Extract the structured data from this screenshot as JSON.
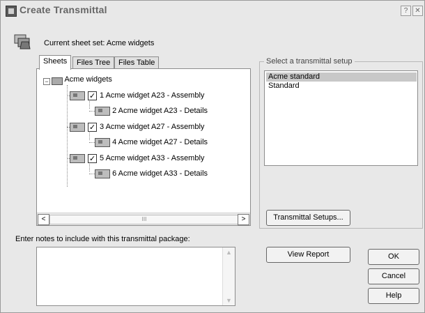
{
  "window": {
    "title": "Create Transmittal"
  },
  "titlebar_buttons": {
    "help": "?",
    "close": "✕"
  },
  "header": {
    "current_sheet_set": "Current sheet set: Acme widgets"
  },
  "tabs": [
    {
      "label": "Sheets",
      "active": true
    },
    {
      "label": "Files Tree",
      "active": false
    },
    {
      "label": "Files Table",
      "active": false
    }
  ],
  "tree": {
    "root": "Acme widgets",
    "expander": "−",
    "items": [
      {
        "label": "1 Acme widget A23 - Assembly",
        "checked": true
      },
      {
        "label": "2 Acme widget A23 - Details",
        "checked": null
      },
      {
        "label": "3 Acme widget A27 - Assembly",
        "checked": true
      },
      {
        "label": "4 Acme widget A27 - Details",
        "checked": null
      },
      {
        "label": "5 Acme widget A33 - Assembly",
        "checked": true
      },
      {
        "label": "6 Acme widget A33 - Details",
        "checked": null
      }
    ],
    "scroll": {
      "left": "<",
      "right": ">",
      "thumb": "III"
    }
  },
  "setup": {
    "group_label": "Select a transmittal setup",
    "items": [
      {
        "label": "Acme standard",
        "selected": true
      },
      {
        "label": "Standard",
        "selected": false
      }
    ],
    "setups_button": "Transmittal Setups..."
  },
  "notes": {
    "label": "Enter notes to include with this transmittal package:",
    "value": "",
    "scroll_up": "▲",
    "scroll_down": "▼"
  },
  "buttons": {
    "view_report": "View Report",
    "ok": "OK",
    "cancel": "Cancel",
    "help": "Help"
  }
}
